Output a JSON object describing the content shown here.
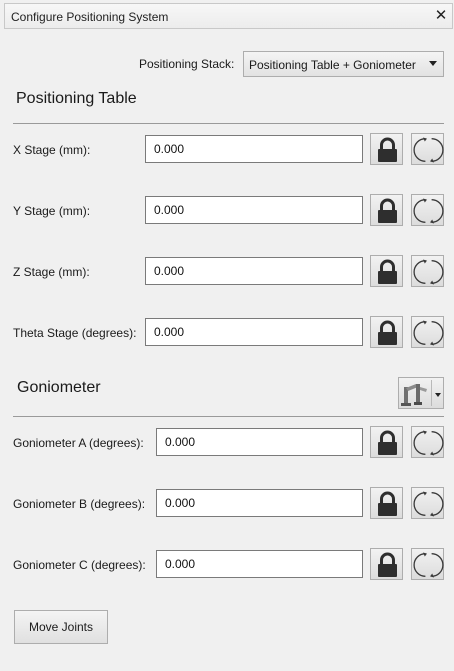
{
  "window": {
    "title": "Configure Positioning System",
    "close_label": "✕"
  },
  "stack": {
    "label": "Positioning Stack:",
    "selected": "Positioning Table + Goniometer"
  },
  "positioning_table": {
    "title": "Positioning Table",
    "rows": [
      {
        "label": "X Stage (mm):",
        "value": "0.000"
      },
      {
        "label": "Y Stage (mm):",
        "value": "0.000"
      },
      {
        "label": "Z Stage (mm):",
        "value": "0.000"
      },
      {
        "label": "Theta Stage (degrees):",
        "value": "0.000"
      }
    ]
  },
  "goniometer": {
    "title": "Goniometer",
    "tool_icon": "goniometer-tool-icon",
    "rows": [
      {
        "label": "Goniometer A (degrees):",
        "value": "0.000"
      },
      {
        "label": "Goniometer B (degrees):",
        "value": "0.000"
      },
      {
        "label": "Goniometer C (degrees):",
        "value": "0.000"
      }
    ]
  },
  "icons": {
    "lock": "lock-icon",
    "reset": "reset-rotation-icon"
  },
  "actions": {
    "move_joints": "Move Joints"
  }
}
